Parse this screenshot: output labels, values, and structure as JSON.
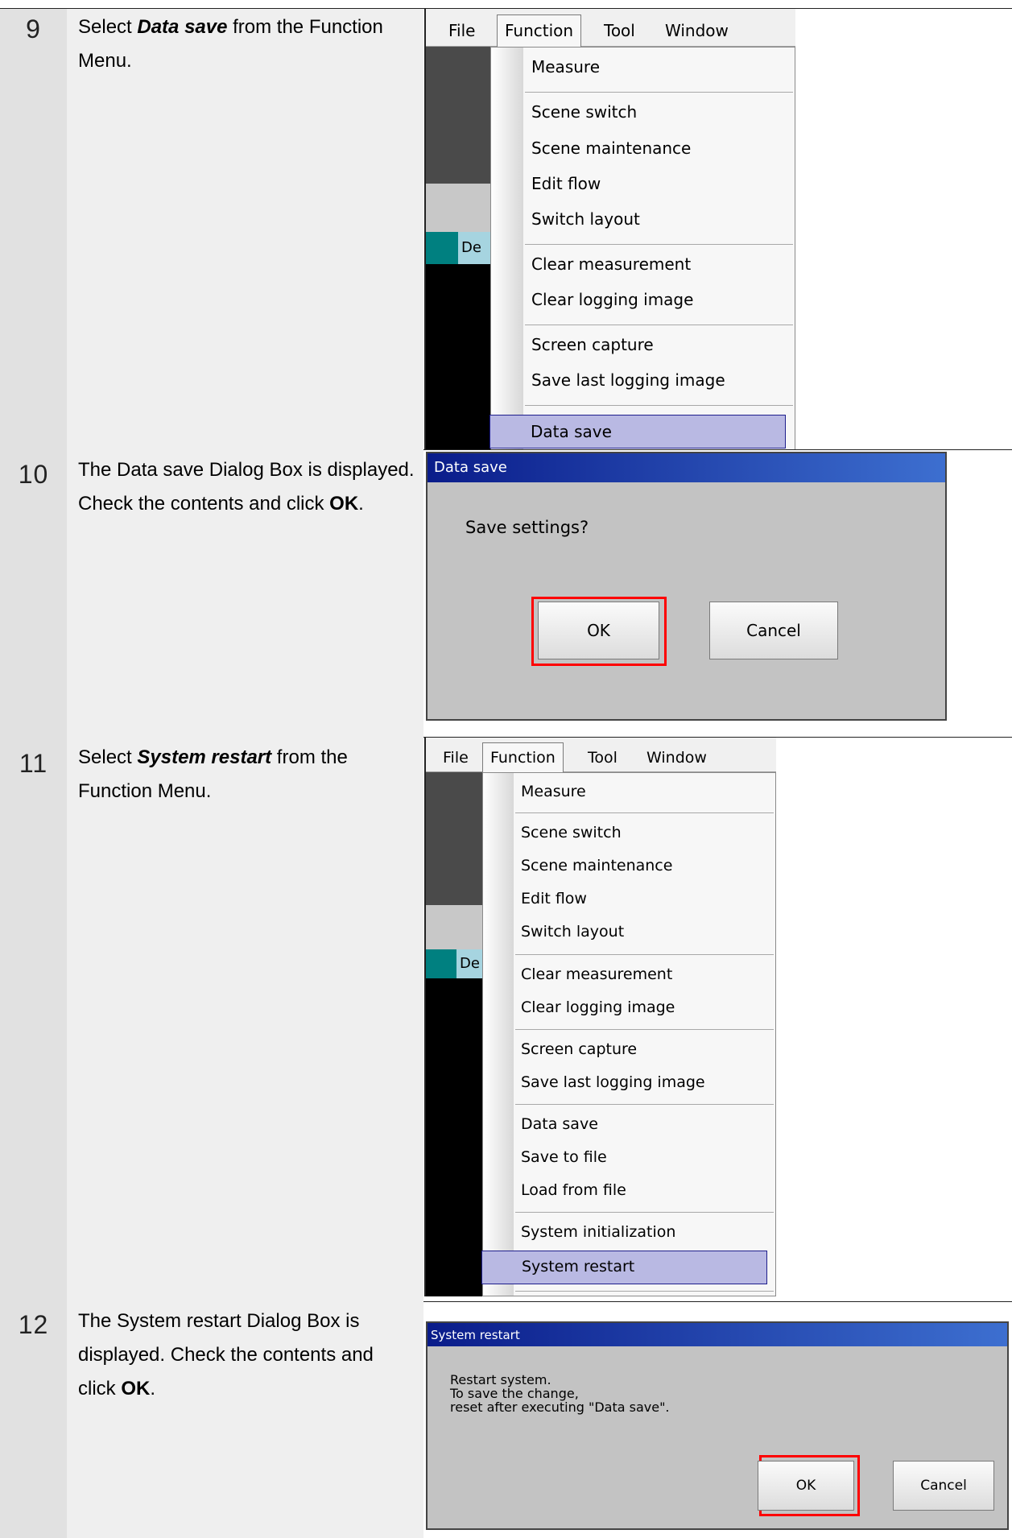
{
  "steps": [
    {
      "number": "9",
      "desc": {
        "pre": "Select ",
        "em": "Data save",
        "post": " from the Function Menu."
      },
      "menubar": [
        "File",
        "Function",
        "Tool",
        "Window"
      ],
      "side_label": "De",
      "menu_groups": [
        [
          "Measure"
        ],
        [
          "Scene switch",
          "Scene maintenance",
          "Edit flow",
          "Switch layout"
        ],
        [
          "Clear measurement",
          "Clear logging image"
        ],
        [
          "Screen capture",
          "Save last logging image"
        ],
        [
          "Data save"
        ]
      ],
      "highlighted": "Data save"
    },
    {
      "number": "10",
      "desc": {
        "pre": "The Data save Dialog Box is displayed. Check the contents and click ",
        "bold": "OK",
        "post": "."
      },
      "dialog": {
        "title": "Data save",
        "message": "Save settings?",
        "ok": "OK",
        "cancel": "Cancel"
      }
    },
    {
      "number": "11",
      "desc": {
        "pre": "Select ",
        "em": "System restart",
        "post": " from the Function Menu."
      },
      "menubar": [
        "File",
        "Function",
        "Tool",
        "Window"
      ],
      "side_label": "De",
      "menu_groups": [
        [
          "Measure"
        ],
        [
          "Scene switch",
          "Scene maintenance",
          "Edit flow",
          "Switch layout"
        ],
        [
          "Clear measurement",
          "Clear logging image"
        ],
        [
          "Screen capture",
          "Save last logging image"
        ],
        [
          "Data save",
          "Save to file",
          "Load from file"
        ],
        [
          "System initialization",
          "System restart"
        ]
      ],
      "highlighted": "System restart"
    },
    {
      "number": "12",
      "desc": {
        "pre": "The System restart Dialog Box is displayed. Check the contents and click ",
        "bold": "OK",
        "post": "."
      },
      "dialog": {
        "title": "System restart",
        "message_lines": [
          "Restart system.",
          "To save the change,",
          "reset after executing \"Data save\"."
        ],
        "ok": "OK",
        "cancel": "Cancel"
      }
    }
  ],
  "colors": {
    "highlight": "#b9b9e3",
    "highlight_border": "#1e1e8c",
    "callout": "#ff0000",
    "title_bar": "#0a1c8a"
  }
}
